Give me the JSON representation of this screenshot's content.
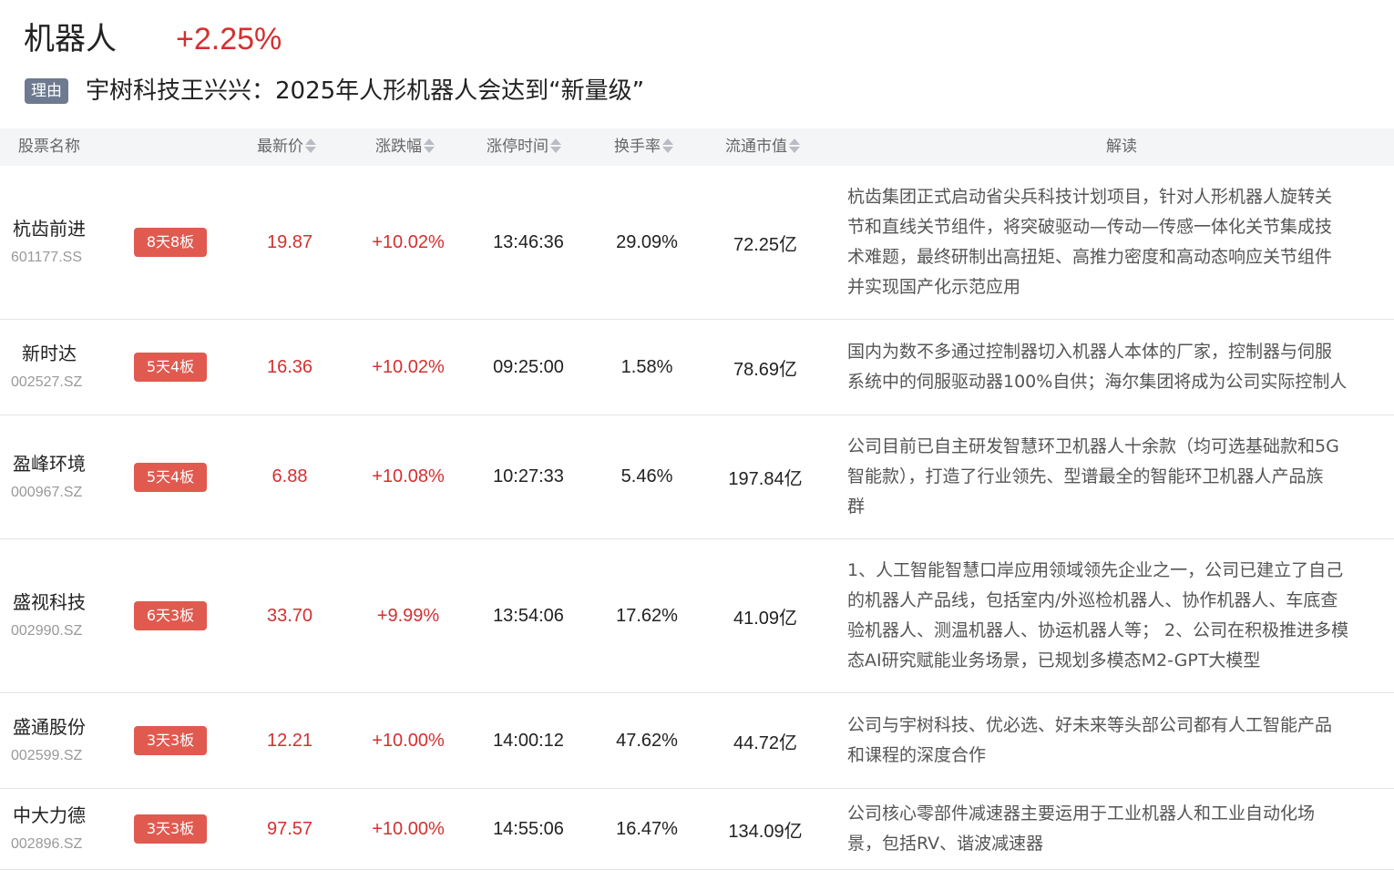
{
  "sector": {
    "name": "机器人",
    "change": "+2.25%"
  },
  "reason": {
    "tag": "理由",
    "text": "宇树科技王兴兴：2025年人形机器人会达到“新量级”"
  },
  "columns": {
    "name": "股票名称",
    "price": "最新价",
    "change": "涨跌幅",
    "limit_time": "涨停时间",
    "turnover": "换手率",
    "float_cap": "流通市值",
    "desc": "解读"
  },
  "colors": {
    "up": "#d43030",
    "badge": "#e05a50",
    "tag": "#6e7a8f",
    "header_bg": "#f4f5f7"
  },
  "rows": [
    {
      "name": "杭齿前进",
      "code": "601177.SS",
      "badge": "8天8板",
      "price": "19.87",
      "change": "+10.02%",
      "limit_time": "13:46:36",
      "turnover": "29.09%",
      "float_cap": "72.25亿",
      "desc": "杭齿集团正式启动省尖兵科技计划项目，针对人形机器人旋转关\n节和直线关节组件，将突破驱动—传动—传感一体化关节集成技\n术难题，最终研制出高扭矩、高推力密度和高动态响应关节组件\n并实现国产化示范应用"
    },
    {
      "name": "新时达",
      "code": "002527.SZ",
      "badge": "5天4板",
      "price": "16.36",
      "change": "+10.02%",
      "limit_time": "09:25:00",
      "turnover": "1.58%",
      "float_cap": "78.69亿",
      "desc": "国内为数不多通过控制器切入机器人本体的厂家，控制器与伺服\n系统中的伺服驱动器100%自供；海尔集团将成为公司实际控制人"
    },
    {
      "name": "盈峰环境",
      "code": "000967.SZ",
      "badge": "5天4板",
      "price": "6.88",
      "change": "+10.08%",
      "limit_time": "10:27:33",
      "turnover": "5.46%",
      "float_cap": "197.84亿",
      "desc": "公司目前已自主研发智慧环卫机器人十余款（均可选基础款和5G\n智能款），打造了行业领先、型谱最全的智能环卫机器人产品族\n群"
    },
    {
      "name": "盛视科技",
      "code": "002990.SZ",
      "badge": "6天3板",
      "price": "33.70",
      "change": "+9.99%",
      "limit_time": "13:54:06",
      "turnover": "17.62%",
      "float_cap": "41.09亿",
      "desc": "1、人工智能智慧口岸应用领域领先企业之一，公司已建立了自己\n的机器人产品线，包括室内/外巡检机器人、协作机器人、车底查\n验机器人、测温机器人、协运机器人等； 2、公司在积极推进多模\n态AI研究赋能业务场景，已规划多模态M2-GPT大模型"
    },
    {
      "name": "盛通股份",
      "code": "002599.SZ",
      "badge": "3天3板",
      "price": "12.21",
      "change": "+10.00%",
      "limit_time": "14:00:12",
      "turnover": "47.62%",
      "float_cap": "44.72亿",
      "desc": "公司与宇树科技、优必选、好未来等头部公司都有人工智能产品\n和课程的深度合作"
    },
    {
      "name": "中大力德",
      "code": "002896.SZ",
      "badge": "3天3板",
      "price": "97.57",
      "change": "+10.00%",
      "limit_time": "14:55:06",
      "turnover": "16.47%",
      "float_cap": "134.09亿",
      "desc": "公司核心零部件减速器主要运用于工业机器人和工业自动化场\n景，包括RV、谐波减速器"
    }
  ]
}
